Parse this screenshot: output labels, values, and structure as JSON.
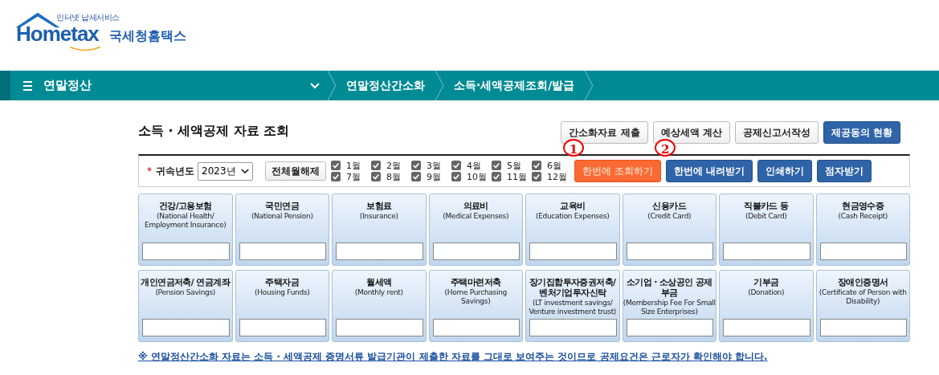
{
  "logo": {
    "tagline": "인터넷 납세서비스",
    "wordmark": "Hometax",
    "name": "국세청홈택스"
  },
  "nav": {
    "menu": "연말정산",
    "crumbs": [
      "연말정산간소화",
      "소득·세액공제조회/발급"
    ]
  },
  "title": "소득 · 세액공제 자료 조회",
  "top_buttons": [
    {
      "label": "간소화자료 제출",
      "kind": "plain"
    },
    {
      "label": "예상세액 계산",
      "kind": "plain"
    },
    {
      "label": "공제신고서작성",
      "kind": "plain"
    },
    {
      "label": "제공동의 현황",
      "kind": "primary"
    }
  ],
  "filter": {
    "required_mark": "*",
    "label": "귀속년도",
    "year": "2023년",
    "clear_button": "전체월해제",
    "months": [
      {
        "label": "1월",
        "checked": true
      },
      {
        "label": "2월",
        "checked": true
      },
      {
        "label": "3월",
        "checked": true
      },
      {
        "label": "4월",
        "checked": true
      },
      {
        "label": "5월",
        "checked": true
      },
      {
        "label": "6월",
        "checked": true
      },
      {
        "label": "7월",
        "checked": true
      },
      {
        "label": "8월",
        "checked": true
      },
      {
        "label": "9월",
        "checked": true
      },
      {
        "label": "10월",
        "checked": true
      },
      {
        "label": "11월",
        "checked": true
      },
      {
        "label": "12월",
        "checked": true
      }
    ],
    "actions": [
      {
        "label": "한번에 조회하기",
        "kind": "accent",
        "annotation": "1"
      },
      {
        "label": "한번에 내려받기",
        "kind": "primary",
        "annotation": "2"
      },
      {
        "label": "인쇄하기",
        "kind": "primary"
      },
      {
        "label": "점자받기",
        "kind": "primary"
      }
    ]
  },
  "cards": [
    {
      "title": "건강/고용보험",
      "subtitle": "(National Health/ Employment Insurance)"
    },
    {
      "title": "국민연금",
      "subtitle": "(National Pension)"
    },
    {
      "title": "보험료",
      "subtitle": "(Insurance)"
    },
    {
      "title": "의료비",
      "subtitle": "(Medical Expenses)"
    },
    {
      "title": "교육비",
      "subtitle": "(Education Expenses)"
    },
    {
      "title": "신용카드",
      "subtitle": "(Credit Card)"
    },
    {
      "title": "직불카드 등",
      "subtitle": "(Debit Card)"
    },
    {
      "title": "현금영수증",
      "subtitle": "(Cash Receipt)"
    },
    {
      "title": "개인연금저축/ 연금계좌",
      "subtitle": "(Pension Savings)"
    },
    {
      "title": "주택자금",
      "subtitle": "(Housing Funds)"
    },
    {
      "title": "월세액",
      "subtitle": "(Monthly rent)"
    },
    {
      "title": "주택마련저축",
      "subtitle": "(Home Purchasing Savings)"
    },
    {
      "title": "장기집합투자증권저축/ 벤처기업투자신탁",
      "subtitle": "(LT investment savings/ Venture investment trust)"
    },
    {
      "title": "소기업 · 소상공인 공제부금",
      "subtitle": "(Membership Fee For Small Size Enterprises)"
    },
    {
      "title": "기부금",
      "subtitle": "(Donation)"
    },
    {
      "title": "장애인증명서",
      "subtitle": "(Certificate of Person with Disability)"
    }
  ],
  "notice": "※ 연말정산간소화 자료는 소득 · 세액공제 증명서류 발급기관이 제출한 자료를 그대로 보여주는 것이므로 공제요건은 근로자가 확인해야 합니다."
}
